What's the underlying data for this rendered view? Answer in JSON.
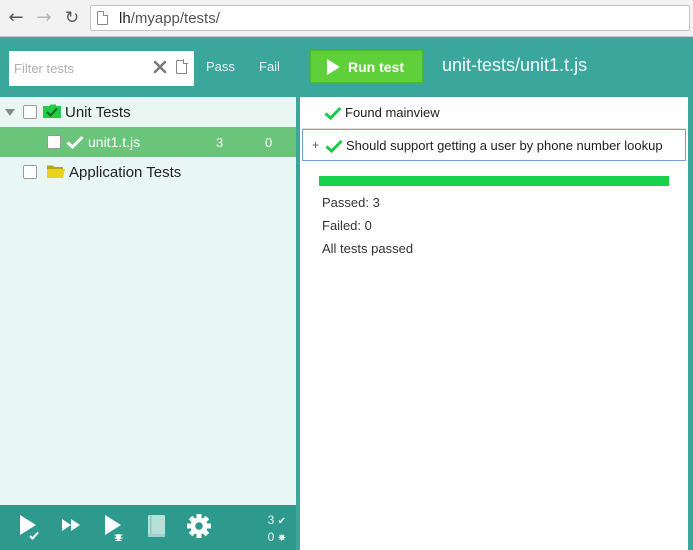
{
  "browser": {
    "url_host": "lh",
    "url_path": "/myapp/tests/"
  },
  "toolbar": {
    "filter_placeholder": "Filter tests",
    "pass_label": "Pass",
    "fail_label": "Fail",
    "run_label": "Run test",
    "title": "unit-tests/unit1.t.js"
  },
  "tree": {
    "unit_tests_label": "Unit Tests",
    "file": {
      "label": "unit1.t.js",
      "passed": "3",
      "failed": "0"
    },
    "application_tests_label": "Application Tests"
  },
  "results": {
    "rows": [
      {
        "plus": "",
        "label": "Found mainview"
      },
      {
        "plus": "+",
        "label": "Should support getting a user by phone number lookup"
      }
    ],
    "progress_fraction": 1.0,
    "passed_text": "Passed: 3",
    "failed_text": "Failed: 0",
    "status_text": "All tests passed"
  },
  "bottom": {
    "passed_count": "3",
    "failed_count": "0"
  },
  "colors": {
    "accent": "#3aa69c",
    "run_button": "#5fcf3a",
    "progress": "#18d24c",
    "check": "#18c94a",
    "folder_open": "#22cc44",
    "folder_closed": "#e8d21d"
  },
  "icons": [
    "back-icon",
    "forward-icon",
    "reload-icon",
    "page-icon",
    "clear-icon",
    "document-icon",
    "play-icon",
    "folder-icon",
    "check-icon",
    "run-icon",
    "run-all-icon",
    "debug-icon",
    "book-icon",
    "gear-icon",
    "bug-icon"
  ]
}
